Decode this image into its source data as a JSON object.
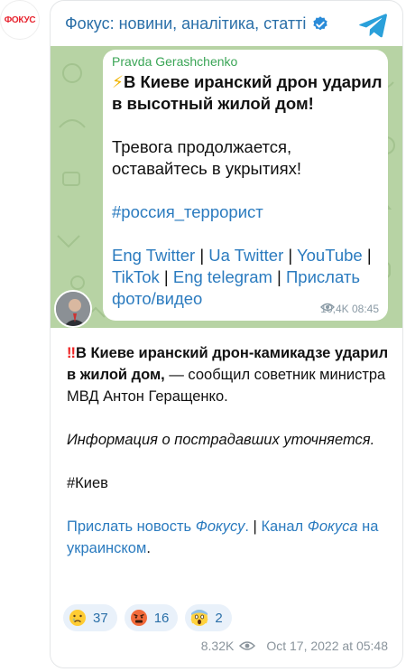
{
  "source": {
    "logo_text": "ФОКУС"
  },
  "header": {
    "channel_name": "Фокус: новини, аналітика, статті",
    "verified_icon": "verified-badge-icon",
    "app_icon": "telegram-icon"
  },
  "forwarded": {
    "author": "Pravda Gerashchenko",
    "headline": "В Киеве иранский дрон ударил в высотный жилой дом!",
    "line2": "Тревога продолжается, оставайтесь в укрытиях!",
    "hashtag": "#россия_террорист",
    "links": [
      "Eng Twitter",
      "Ua Twitter",
      "YouTube",
      "TikTok",
      "Eng telegram",
      "Прислать фото/видео"
    ],
    "views": "10,4K",
    "time": "08:45"
  },
  "post": {
    "lead_bold": "В Киеве иранский дрон-камикадзе ударил в жилой дом,",
    "lead_rest": " — сообщил советник министра МВД Антон Геращенко.",
    "note": "Информация о пострадавших уточняется.",
    "tag": "#Киев",
    "link1_a": "Прислать новость ",
    "link1_b": "Фокусу",
    "link1_c": ".",
    "divider": " | ",
    "link2_a": "Канал ",
    "link2_b": "Фокуса",
    "link2_c": " на украинском",
    "end": "."
  },
  "reactions": [
    {
      "emoji": "crying-face",
      "count": "37"
    },
    {
      "emoji": "angry-face",
      "count": "16"
    },
    {
      "emoji": "screaming-face",
      "count": "2"
    }
  ],
  "footer": {
    "views": "8.32K",
    "date": "Oct 17, 2022 at 05:48"
  },
  "colors": {
    "link": "#2b7bbf",
    "channel": "#2a6fa8",
    "chat_bg": "#b7d3a4",
    "author": "#3aa556"
  }
}
